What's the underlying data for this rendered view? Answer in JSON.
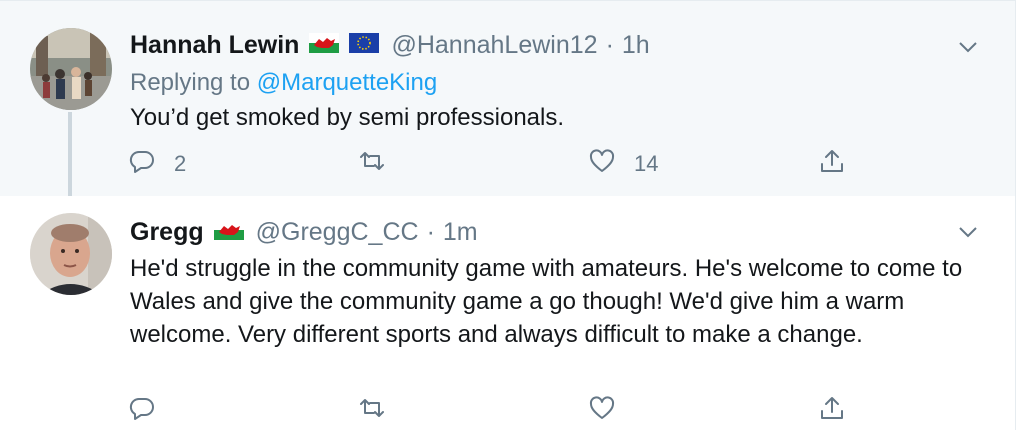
{
  "tweets": [
    {
      "name": "Hannah Lewin",
      "handle": "@HannahLewin12",
      "separator": "·",
      "time": "1h",
      "replying_prefix": "Replying to",
      "replying_handle": "@MarquetteKing",
      "text": "You’d get smoked by semi professionals.",
      "replies": "2",
      "retweets": "",
      "likes": "14",
      "flags": [
        "wales-flag-icon",
        "eu-flag-icon"
      ]
    },
    {
      "name": "Gregg",
      "handle": "@GreggC_CC",
      "separator": "·",
      "time": "1m",
      "text": "He'd struggle in the community game with amateurs. He's welcome to come to Wales and give the community game a go though! We'd give him a warm welcome. Very different sports and always difficult to make a change.",
      "replies": "",
      "retweets": "",
      "likes": "",
      "flags": [
        "wales-flag-icon"
      ]
    }
  ],
  "colors": {
    "accent": "#1da1f2",
    "secondary_text": "#657786",
    "primary_text": "#14171a",
    "highlight_bg": "#f5f8fa"
  }
}
